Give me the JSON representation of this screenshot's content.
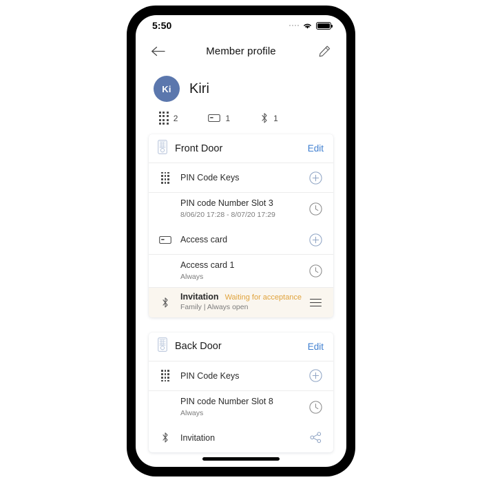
{
  "statusbar": {
    "time": "5:50",
    "wifi_icon": "wifi-icon",
    "battery_icon": "battery-icon",
    "signal_icon": "signal-dots-icon"
  },
  "navbar": {
    "back_icon": "back-arrow-icon",
    "title": "Member profile",
    "edit_icon": "pencil-icon"
  },
  "profile": {
    "avatar_initials": "Ki",
    "avatar_color": "#5b77ad",
    "name": "Kiri",
    "stats": [
      {
        "icon": "keypad-icon",
        "count": "2"
      },
      {
        "icon": "access-card-icon",
        "count": "1"
      },
      {
        "icon": "bluetooth-icon",
        "count": "1"
      }
    ]
  },
  "colors": {
    "link": "#3f7fd0",
    "warning": "#e0a33c",
    "invitation_bg": "#faf6ef",
    "icon_blue": "#8fa4c4"
  },
  "doors": [
    {
      "id": "front-door",
      "icon": "door-lock-icon",
      "title": "Front Door",
      "edit_label": "Edit",
      "rows": [
        {
          "type": "header",
          "name": "pin-code-keys",
          "icon": "keypad-icon",
          "label": "PIN Code Keys",
          "action_icon": "plus-circle-icon"
        },
        {
          "type": "detail",
          "name": "pin-code-slot",
          "title": "PIN code Number Slot 3",
          "subtitle": "8/06/20 17:28 - 8/07/20 17:29",
          "action_icon": "clock-icon"
        },
        {
          "type": "header",
          "name": "access-card",
          "icon": "access-card-icon",
          "label": "Access card",
          "action_icon": "plus-circle-icon"
        },
        {
          "type": "detail",
          "name": "access-card-entry",
          "title": "Access card 1",
          "subtitle": "Always",
          "action_icon": "clock-icon"
        },
        {
          "type": "invitation",
          "name": "invitation",
          "icon": "bluetooth-icon",
          "title": "Invitation",
          "status": "Waiting for acceptance",
          "subtitle": "Family | Always open",
          "action_icon": "hamburger-menu-icon"
        }
      ]
    },
    {
      "id": "back-door",
      "icon": "door-lock-icon",
      "title": "Back Door",
      "edit_label": "Edit",
      "rows": [
        {
          "type": "header",
          "name": "pin-code-keys",
          "icon": "keypad-icon",
          "label": "PIN Code Keys",
          "action_icon": "plus-circle-icon"
        },
        {
          "type": "detail",
          "name": "pin-code-slot",
          "title": "PIN code Number Slot 8",
          "subtitle": "Always",
          "action_icon": "clock-icon"
        },
        {
          "type": "header",
          "name": "invitation",
          "icon": "bluetooth-icon",
          "label": "Invitation",
          "action_icon": "share-icon"
        }
      ]
    }
  ]
}
